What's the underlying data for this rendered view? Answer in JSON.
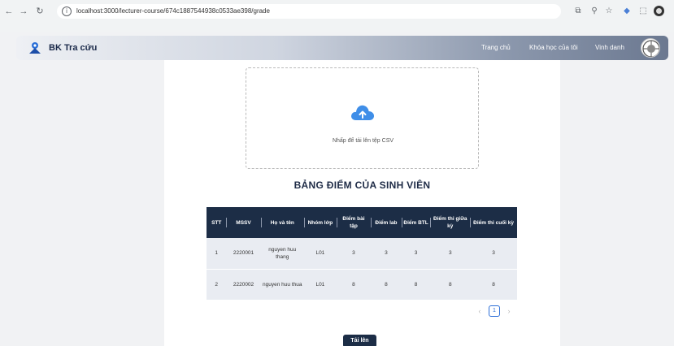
{
  "browser": {
    "url": "localhost:3000/lecturer-course/674c1887544938c0533ae398/grade"
  },
  "navbar": {
    "brand": "BK Tra cứu",
    "links": [
      "Trang chủ",
      "Khóa học của tôi",
      "Vinh danh"
    ]
  },
  "upload": {
    "drop_text": "Nhấp để tải lên tệp CSV",
    "button_label": "Tải lên"
  },
  "table": {
    "title": "BẢNG ĐIỂM CỦA SINH VIÊN",
    "headers": [
      "STT",
      "MSSV",
      "Họ và tên",
      "Nhóm lớp",
      "Điểm bài tập",
      "Điểm lab",
      "Điểm BTL",
      "Điểm thi giữa kỳ",
      "Điểm thi cuối kỳ"
    ],
    "rows": [
      [
        "1",
        "2220001",
        "nguyen huu thang",
        "L01",
        "3",
        "3",
        "3",
        "3",
        "3"
      ],
      [
        "2",
        "2220002",
        "nguyen huu thua",
        "L01",
        "8",
        "8",
        "8",
        "8",
        "8"
      ]
    ]
  },
  "pagination": {
    "current_page": "1"
  },
  "colors": {
    "header_dark": "#1c2d46",
    "row_bg": "#e9ecf2",
    "accent": "#2d6fd8"
  }
}
